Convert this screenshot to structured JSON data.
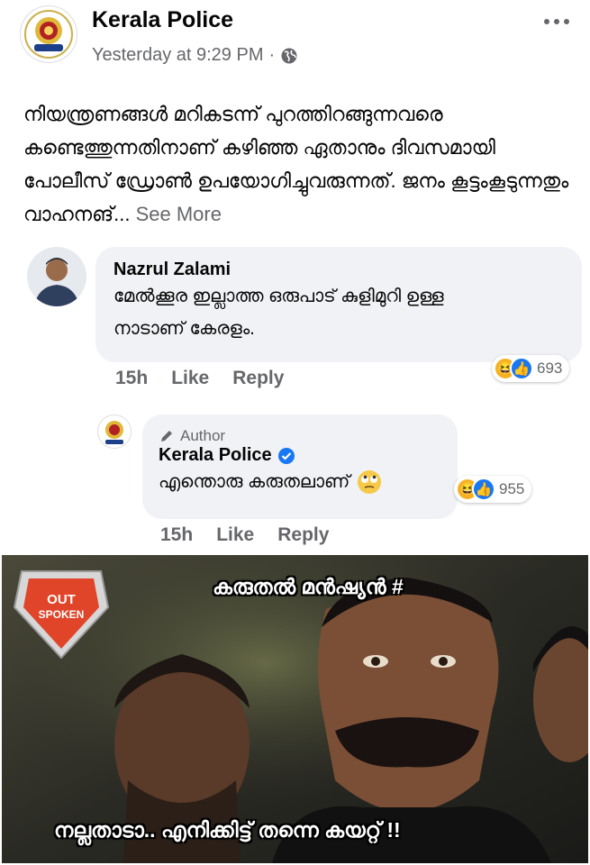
{
  "post": {
    "page_name": "Kerala Police",
    "timestamp": "Yesterday at 9:29 PM",
    "separator": "·",
    "body": "നിയന്ത്രണങ്ങൾ മറികടന്ന് പുറത്തിറങ്ങുന്നവരെ കണ്ടെത്തുന്നതിനാണ് കഴിഞ്ഞ ഏതാനും ദിവസമായി പോലീസ് ഡ്രോൺ ഉപയോഗിച്ചുവരുന്നത്. ജനം കൂട്ടംകൂടുന്നതും വാഹനങ്...",
    "see_more": "See More"
  },
  "comments": [
    {
      "author": "Nazrul Zalami",
      "text_line1": "മേൽക്കൂര ഇല്ലാത്ത ഒരുപാട് കുളിമുറി ഉള്ള",
      "text_line2": "നാടാണ് കേരളം.",
      "time": "15h",
      "like": "Like",
      "reply": "Reply",
      "reaction_count": "693"
    },
    {
      "author_badge": "Author",
      "author": "Kerala Police",
      "text": "എന്തൊരു കരുതലാണ്",
      "time": "15h",
      "like": "Like",
      "reply": "Reply",
      "reaction_count": "955"
    }
  ],
  "meme": {
    "logo_top": "OUT",
    "logo_bottom": "SPOKEN",
    "top_caption": "കരുതൽ മൻഷ്യൻ #",
    "bottom_caption": "നല്ലതാടാ.. എനിക്കിട്ട് തന്നെ കയറ്റ് !!"
  },
  "icons": {
    "globe": "globe-icon",
    "more": "more-horizontal-icon",
    "verified": "verified-badge-icon",
    "pencil": "pencil-icon",
    "haha": "haha-reaction-icon",
    "like": "like-reaction-icon",
    "rolling_eyes": "rolling-eyes-emoji-icon"
  },
  "colors": {
    "link_blue": "#1877f2",
    "meta_gray": "#65676b",
    "bubble_bg": "#f0f2f5",
    "haha_yellow": "#f7b125"
  }
}
